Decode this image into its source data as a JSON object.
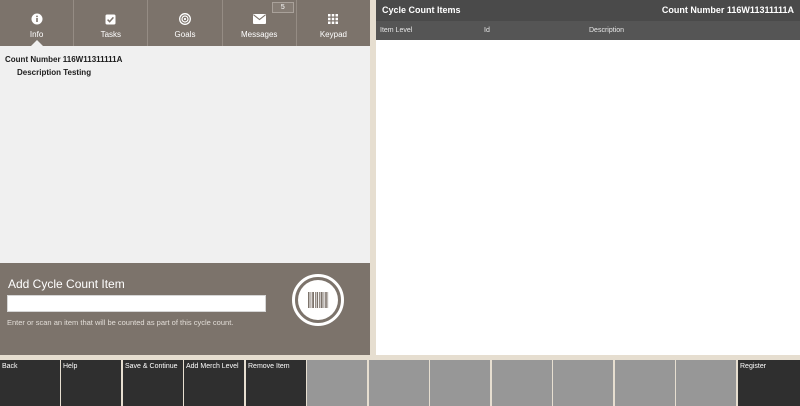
{
  "tabs": [
    {
      "label": "Info",
      "icon": "info-icon",
      "active": true
    },
    {
      "label": "Tasks",
      "icon": "tasks-icon"
    },
    {
      "label": "Goals",
      "icon": "goals-icon"
    },
    {
      "label": "Messages",
      "icon": "messages-icon",
      "badge": "5"
    },
    {
      "label": "Keypad",
      "icon": "keypad-icon"
    }
  ],
  "count_info": {
    "count_number": "Count Number 116W11311111A",
    "description": "Description Testing"
  },
  "add_item": {
    "title": "Add Cycle Count Item",
    "input_value": "",
    "hint": "Enter or scan an item that will be counted as part of this cycle count."
  },
  "cycle_items": {
    "title": "Cycle Count Items",
    "count_number": "Count Number 116W11311111A",
    "columns": [
      "Item Level",
      "Id",
      "Description"
    ],
    "rows": []
  },
  "toolbar": {
    "buttons": [
      "Back",
      "Help",
      "Save & Continue",
      "Add Merch Level",
      "Remove Item",
      "",
      "",
      "",
      "",
      "",
      "",
      "",
      "Register"
    ]
  },
  "colors": {
    "panel_header": "#7c736b",
    "table_header": "#4a4a4a",
    "toolbar_dark": "#2f2f2f",
    "toolbar_disabled": "#979797",
    "background": "#e6ded0"
  }
}
